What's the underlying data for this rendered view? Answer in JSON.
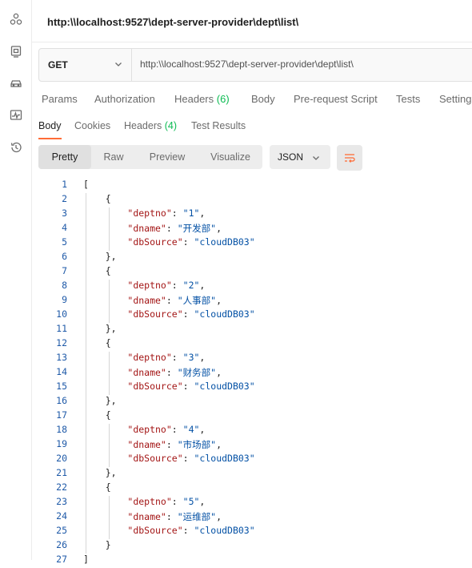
{
  "rail": {
    "icons": [
      "collections-icon",
      "environments-icon",
      "mock-servers-icon",
      "monitors-icon",
      "history-icon"
    ]
  },
  "request": {
    "title": "http:\\\\localhost:9527\\dept-server-provider\\dept\\list\\",
    "method": "GET",
    "url": "http:\\\\localhost:9527\\dept-server-provider\\dept\\list\\"
  },
  "request_tabs": {
    "params": "Params",
    "authorization": "Authorization",
    "headers": "Headers",
    "headers_count": "(6)",
    "body": "Body",
    "prerequest": "Pre-request Script",
    "tests": "Tests",
    "settings": "Settings"
  },
  "response_tabs": {
    "body": "Body",
    "cookies": "Cookies",
    "headers": "Headers",
    "headers_count": "(4)",
    "test_results": "Test Results"
  },
  "view_modes": {
    "pretty": "Pretty",
    "raw": "Raw",
    "preview": "Preview",
    "visualize": "Visualize"
  },
  "format": "JSON",
  "accent_color": "#ff6c37",
  "response": [
    {
      "deptno": "1",
      "dname": "开发部",
      "dbSource": "cloudDB03"
    },
    {
      "deptno": "2",
      "dname": "人事部",
      "dbSource": "cloudDB03"
    },
    {
      "deptno": "3",
      "dname": "财务部",
      "dbSource": "cloudDB03"
    },
    {
      "deptno": "4",
      "dname": "市场部",
      "dbSource": "cloudDB03"
    },
    {
      "deptno": "5",
      "dname": "运维部",
      "dbSource": "cloudDB03"
    }
  ]
}
